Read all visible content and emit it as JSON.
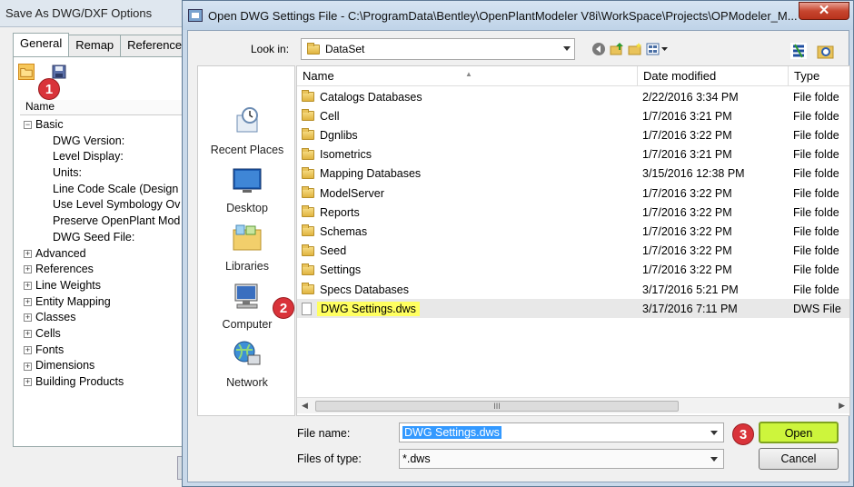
{
  "bg_window": {
    "title": "Save As DWG/DXF Options",
    "tabs": [
      "General",
      "Remap",
      "References"
    ],
    "name_header": "Name",
    "tree": [
      {
        "label": "Basic",
        "expander": "⊟"
      },
      {
        "label": "DWG Version:",
        "prop": true
      },
      {
        "label": "Level Display:",
        "prop": true
      },
      {
        "label": "Units:",
        "prop": true
      },
      {
        "label": "Line Code Scale (Design",
        "prop": true
      },
      {
        "label": "Use Level Symbology Ov",
        "prop": true
      },
      {
        "label": "Preserve OpenPlant Mod",
        "prop": true
      },
      {
        "label": "DWG Seed File:",
        "prop": true
      },
      {
        "label": "Advanced",
        "expander": "⊞"
      },
      {
        "label": "References",
        "expander": "⊞"
      },
      {
        "label": "Line Weights",
        "expander": "⊞"
      },
      {
        "label": "Entity Mapping",
        "expander": "⊞"
      },
      {
        "label": "Classes",
        "expander": "⊞"
      },
      {
        "label": "Cells",
        "expander": "⊞"
      },
      {
        "label": "Fonts",
        "expander": "⊞"
      },
      {
        "label": "Dimensions",
        "expander": "⊞"
      },
      {
        "label": "Building Products",
        "expander": "⊞"
      }
    ]
  },
  "dialog": {
    "title": "Open DWG Settings File - C:\\ProgramData\\Bentley\\OpenPlantModeler V8i\\WorkSpace\\Projects\\OPModeler_M...",
    "close_label": "✕",
    "look_in_label": "Look in:",
    "look_in_value": "DataSet",
    "places": [
      "Recent Places",
      "Desktop",
      "Libraries",
      "Computer",
      "Network"
    ],
    "columns": [
      "Name",
      "Date modified",
      "Type"
    ],
    "files": [
      {
        "name": "Catalogs Databases",
        "date": "2/22/2016 3:34 PM",
        "type": "File folde",
        "kind": "folder"
      },
      {
        "name": "Cell",
        "date": "1/7/2016 3:21 PM",
        "type": "File folde",
        "kind": "folder"
      },
      {
        "name": "Dgnlibs",
        "date": "1/7/2016 3:22 PM",
        "type": "File folde",
        "kind": "folder"
      },
      {
        "name": "Isometrics",
        "date": "1/7/2016 3:21 PM",
        "type": "File folde",
        "kind": "folder"
      },
      {
        "name": "Mapping Databases",
        "date": "3/15/2016 12:38 PM",
        "type": "File folde",
        "kind": "folder"
      },
      {
        "name": "ModelServer",
        "date": "1/7/2016 3:22 PM",
        "type": "File folde",
        "kind": "folder"
      },
      {
        "name": "Reports",
        "date": "1/7/2016 3:22 PM",
        "type": "File folde",
        "kind": "folder"
      },
      {
        "name": "Schemas",
        "date": "1/7/2016 3:22 PM",
        "type": "File folde",
        "kind": "folder"
      },
      {
        "name": "Seed",
        "date": "1/7/2016 3:22 PM",
        "type": "File folde",
        "kind": "folder"
      },
      {
        "name": "Settings",
        "date": "1/7/2016 3:22 PM",
        "type": "File folde",
        "kind": "folder"
      },
      {
        "name": "Specs Databases",
        "date": "3/17/2016 5:21 PM",
        "type": "File folde",
        "kind": "folder"
      },
      {
        "name": "DWG Settings.dws",
        "date": "3/17/2016 7:11 PM",
        "type": "DWS File",
        "kind": "file",
        "selected": true
      }
    ],
    "file_name_label": "File name:",
    "file_name_value": "DWG Settings.dws",
    "files_of_type_label": "Files of type:",
    "files_of_type_value": "*.dws",
    "open_label": "Open",
    "cancel_label": "Cancel",
    "scroll_grip": "III"
  },
  "callouts": [
    "1",
    "2",
    "3"
  ],
  "colors": {
    "highlight": "#ffff60",
    "open_button": "#cdf53c",
    "callout": "#d9333a"
  }
}
